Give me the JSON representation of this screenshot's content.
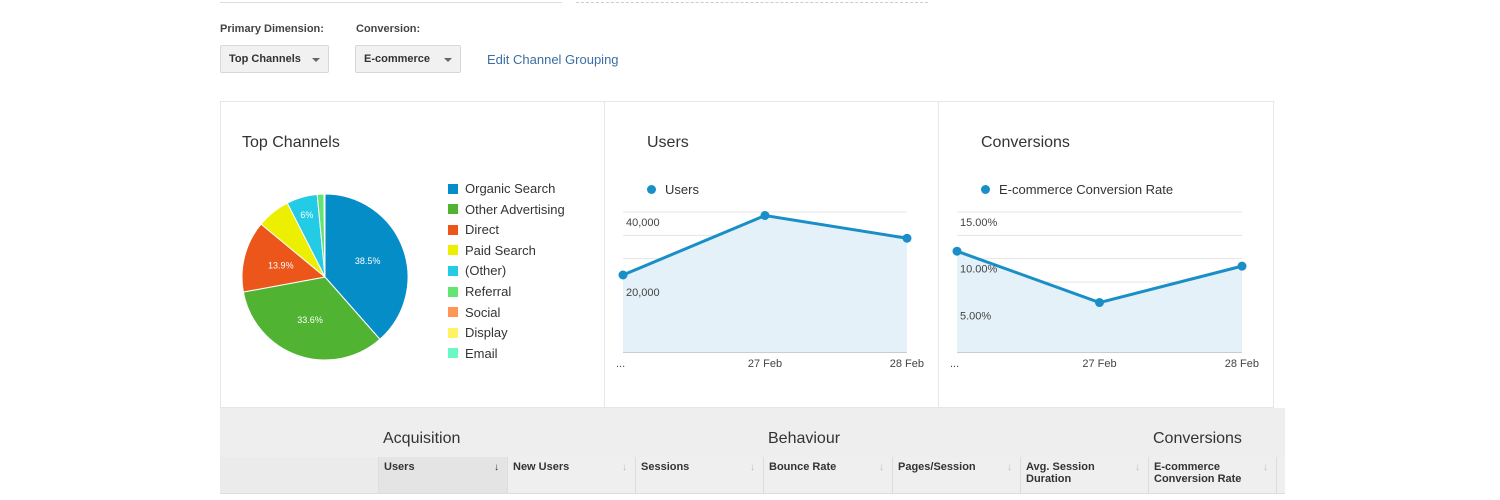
{
  "controls": {
    "primary_dimension_label": "Primary Dimension:",
    "primary_dimension_value": "Top Channels",
    "conversion_label": "Conversion:",
    "conversion_value": "E-commerce",
    "edit_link": "Edit Channel Grouping"
  },
  "charts": {
    "pie_title": "Top Channels",
    "users_title": "Users",
    "conversions_title": "Conversions"
  },
  "chart_data": [
    {
      "type": "pie",
      "title": "Top Channels",
      "categories": [
        "Organic Search",
        "Other Advertising",
        "Direct",
        "Paid Search",
        "(Other)",
        "Referral",
        "Social",
        "Display",
        "Email"
      ],
      "values": [
        38.5,
        33.6,
        13.9,
        6.5,
        6.0,
        1.3,
        0.2,
        0.0,
        0.0
      ],
      "slice_labels": [
        "38.5%",
        "33.6%",
        "13.9%",
        "",
        "6%",
        "",
        "",
        "",
        ""
      ],
      "colors": [
        "#058dc7",
        "#50b432",
        "#ed561b",
        "#edef00",
        "#24cbe5",
        "#64e572",
        "#ff9655",
        "#fff263",
        "#6af9c4"
      ],
      "legend": "right"
    },
    {
      "type": "area",
      "title": "Users",
      "series": [
        {
          "name": "Users",
          "values": [
            22000,
            39000,
            32500
          ]
        }
      ],
      "x": [
        "...",
        "27 Feb",
        "28 Feb"
      ],
      "y_ticks": [
        "40,000",
        "20,000"
      ],
      "ylim": [
        0,
        40000
      ],
      "color": "#1a8fc7"
    },
    {
      "type": "area",
      "title": "Conversions",
      "series": [
        {
          "name": "E-commerce Conversion Rate",
          "values": [
            10.8,
            5.3,
            9.2
          ]
        }
      ],
      "x": [
        "...",
        "27 Feb",
        "28 Feb"
      ],
      "y_ticks": [
        "15.00%",
        "10.00%",
        "5.00%"
      ],
      "ylim": [
        0,
        15
      ],
      "color": "#1a8fc7"
    }
  ],
  "table": {
    "groups": [
      {
        "title": "Acquisition"
      },
      {
        "title": "Behaviour"
      },
      {
        "title": "Conversions"
      }
    ],
    "headers": [
      {
        "label": "Users",
        "arrow": "↓"
      },
      {
        "label": "New Users",
        "arrow": "↓"
      },
      {
        "label": "Sessions",
        "arrow": "↓"
      },
      {
        "label": "Bounce Rate",
        "arrow": "↓"
      },
      {
        "label": "Pages/Session",
        "arrow": "↓"
      },
      {
        "label": "Avg. Session Duration",
        "arrow": "↓"
      },
      {
        "label": "E-commerce Conversion Rate",
        "arrow": "↓"
      }
    ]
  }
}
